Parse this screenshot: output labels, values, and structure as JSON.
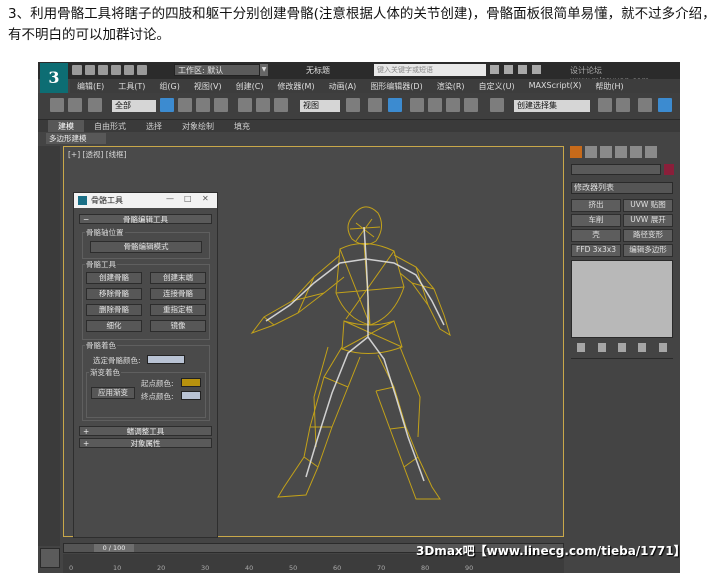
{
  "intro": {
    "text": "3、利用骨骼工具将瞎子的四肢和躯干分别创建骨骼(注意根据人体的关节创建)，骨骼面板很简单易懂，就不过多介绍，有不明白的可以加群讨论。"
  },
  "app": {
    "logo": "3",
    "workspace_label": "工作区: 默认",
    "doc_title": "无标题",
    "search_placeholder": "键入关键字或短语",
    "watermark_top": "设计论坛 www.missyuan.com",
    "menus": [
      "编辑(E)",
      "工具(T)",
      "组(G)",
      "视图(V)",
      "创建(C)",
      "修改器(M)",
      "动画(A)",
      "图形编辑器(D)",
      "渲染(R)",
      "自定义(U)",
      "MAXScript(X)",
      "帮助(H)"
    ],
    "toolbar": {
      "filter_select": "全部",
      "view_select": "视图",
      "selection_set": "创建选择集"
    },
    "ribbon": {
      "tabs": [
        "建模",
        "自由形式",
        "选择",
        "对象绘制",
        "填充"
      ],
      "sub_label": "多边形建模"
    },
    "viewport_label": "[+] [透视] [线框]",
    "command_panel": {
      "modifier_list": "修改器列表",
      "modifier_buttons": [
        "挤出",
        "UVW 贴图",
        "车削",
        "UVW 展开",
        "壳",
        "路径变形",
        "FFD 3x3x3",
        "编辑多边形"
      ]
    },
    "bone_dialog": {
      "title": "骨骼工具",
      "controls": [
        "—",
        "□",
        "✕"
      ],
      "rollout_main": "骨骼编辑工具",
      "pivot_group": "骨骼轴位置",
      "edit_mode_button": "骨骼编辑模式",
      "tools_group": "骨骼工具",
      "tool_buttons": [
        "创建骨骼",
        "创建末端",
        "移除骨骼",
        "连接骨骼",
        "删除骨骼",
        "重指定根",
        "细化",
        "镜像"
      ],
      "color_group": "骨骼着色",
      "selected_color_label": "选定骨骼颜色:",
      "gradient_group": "渐变着色",
      "apply_gradient_button": "应用渐变",
      "start_color_label": "起点颜色:",
      "end_color_label": "终点颜色:",
      "fin_rollout": "鳍调整工具",
      "object_props_rollout": "对象属性"
    },
    "timeline": {
      "counter": "0 / 100",
      "ticks": [
        "0",
        "10",
        "20",
        "30",
        "40",
        "50",
        "60",
        "70",
        "80",
        "90"
      ]
    },
    "watermark_bottom": "3Dmax吧【www.linecg.com/tieba/1771】",
    "colors": {
      "wireframe": "#c9a617",
      "bone_selected_color": "#b9c3d4",
      "start_color": "#b8920e",
      "end_color": "#b9c3d4",
      "accent": "#3c8bd0"
    }
  }
}
